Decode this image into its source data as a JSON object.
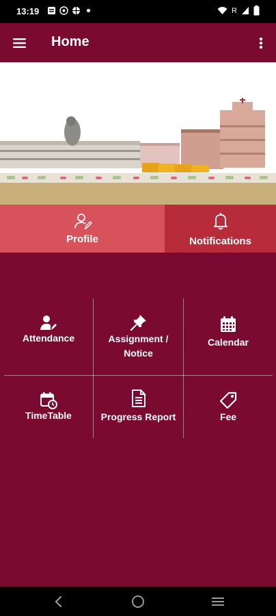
{
  "status_bar": {
    "time": "13:19",
    "network_label": "R"
  },
  "app_bar": {
    "title": "Home"
  },
  "tabs": [
    {
      "label": "Profile"
    },
    {
      "label": "Notifications"
    }
  ],
  "grid": {
    "items": [
      {
        "label": "Attendance",
        "icon": "user-edit-icon"
      },
      {
        "label": "Assignment /\nNotice",
        "icon": "pin-icon"
      },
      {
        "label": "Calendar",
        "icon": "calendar-icon"
      },
      {
        "label": "TimeTable",
        "icon": "calendar-clock-icon"
      },
      {
        "label": "Progress Report",
        "icon": "document-icon"
      },
      {
        "label": "Fee",
        "icon": "tag-icon"
      }
    ]
  },
  "colors": {
    "primary": "#7a0a30",
    "tab_profile": "#d8525b",
    "tab_notifications": "#b72b3a"
  }
}
